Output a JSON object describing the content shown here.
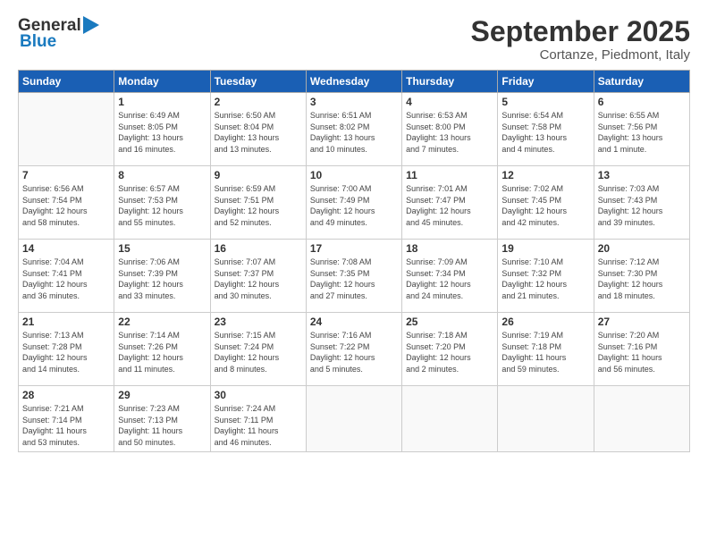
{
  "header": {
    "logo_line1": "General",
    "logo_line2": "Blue",
    "month": "September 2025",
    "location": "Cortanze, Piedmont, Italy"
  },
  "days_of_week": [
    "Sunday",
    "Monday",
    "Tuesday",
    "Wednesday",
    "Thursday",
    "Friday",
    "Saturday"
  ],
  "weeks": [
    [
      {
        "day": "",
        "info": ""
      },
      {
        "day": "1",
        "info": "Sunrise: 6:49 AM\nSunset: 8:05 PM\nDaylight: 13 hours\nand 16 minutes."
      },
      {
        "day": "2",
        "info": "Sunrise: 6:50 AM\nSunset: 8:04 PM\nDaylight: 13 hours\nand 13 minutes."
      },
      {
        "day": "3",
        "info": "Sunrise: 6:51 AM\nSunset: 8:02 PM\nDaylight: 13 hours\nand 10 minutes."
      },
      {
        "day": "4",
        "info": "Sunrise: 6:53 AM\nSunset: 8:00 PM\nDaylight: 13 hours\nand 7 minutes."
      },
      {
        "day": "5",
        "info": "Sunrise: 6:54 AM\nSunset: 7:58 PM\nDaylight: 13 hours\nand 4 minutes."
      },
      {
        "day": "6",
        "info": "Sunrise: 6:55 AM\nSunset: 7:56 PM\nDaylight: 13 hours\nand 1 minute."
      }
    ],
    [
      {
        "day": "7",
        "info": "Sunrise: 6:56 AM\nSunset: 7:54 PM\nDaylight: 12 hours\nand 58 minutes."
      },
      {
        "day": "8",
        "info": "Sunrise: 6:57 AM\nSunset: 7:53 PM\nDaylight: 12 hours\nand 55 minutes."
      },
      {
        "day": "9",
        "info": "Sunrise: 6:59 AM\nSunset: 7:51 PM\nDaylight: 12 hours\nand 52 minutes."
      },
      {
        "day": "10",
        "info": "Sunrise: 7:00 AM\nSunset: 7:49 PM\nDaylight: 12 hours\nand 49 minutes."
      },
      {
        "day": "11",
        "info": "Sunrise: 7:01 AM\nSunset: 7:47 PM\nDaylight: 12 hours\nand 45 minutes."
      },
      {
        "day": "12",
        "info": "Sunrise: 7:02 AM\nSunset: 7:45 PM\nDaylight: 12 hours\nand 42 minutes."
      },
      {
        "day": "13",
        "info": "Sunrise: 7:03 AM\nSunset: 7:43 PM\nDaylight: 12 hours\nand 39 minutes."
      }
    ],
    [
      {
        "day": "14",
        "info": "Sunrise: 7:04 AM\nSunset: 7:41 PM\nDaylight: 12 hours\nand 36 minutes."
      },
      {
        "day": "15",
        "info": "Sunrise: 7:06 AM\nSunset: 7:39 PM\nDaylight: 12 hours\nand 33 minutes."
      },
      {
        "day": "16",
        "info": "Sunrise: 7:07 AM\nSunset: 7:37 PM\nDaylight: 12 hours\nand 30 minutes."
      },
      {
        "day": "17",
        "info": "Sunrise: 7:08 AM\nSunset: 7:35 PM\nDaylight: 12 hours\nand 27 minutes."
      },
      {
        "day": "18",
        "info": "Sunrise: 7:09 AM\nSunset: 7:34 PM\nDaylight: 12 hours\nand 24 minutes."
      },
      {
        "day": "19",
        "info": "Sunrise: 7:10 AM\nSunset: 7:32 PM\nDaylight: 12 hours\nand 21 minutes."
      },
      {
        "day": "20",
        "info": "Sunrise: 7:12 AM\nSunset: 7:30 PM\nDaylight: 12 hours\nand 18 minutes."
      }
    ],
    [
      {
        "day": "21",
        "info": "Sunrise: 7:13 AM\nSunset: 7:28 PM\nDaylight: 12 hours\nand 14 minutes."
      },
      {
        "day": "22",
        "info": "Sunrise: 7:14 AM\nSunset: 7:26 PM\nDaylight: 12 hours\nand 11 minutes."
      },
      {
        "day": "23",
        "info": "Sunrise: 7:15 AM\nSunset: 7:24 PM\nDaylight: 12 hours\nand 8 minutes."
      },
      {
        "day": "24",
        "info": "Sunrise: 7:16 AM\nSunset: 7:22 PM\nDaylight: 12 hours\nand 5 minutes."
      },
      {
        "day": "25",
        "info": "Sunrise: 7:18 AM\nSunset: 7:20 PM\nDaylight: 12 hours\nand 2 minutes."
      },
      {
        "day": "26",
        "info": "Sunrise: 7:19 AM\nSunset: 7:18 PM\nDaylight: 11 hours\nand 59 minutes."
      },
      {
        "day": "27",
        "info": "Sunrise: 7:20 AM\nSunset: 7:16 PM\nDaylight: 11 hours\nand 56 minutes."
      }
    ],
    [
      {
        "day": "28",
        "info": "Sunrise: 7:21 AM\nSunset: 7:14 PM\nDaylight: 11 hours\nand 53 minutes."
      },
      {
        "day": "29",
        "info": "Sunrise: 7:23 AM\nSunset: 7:13 PM\nDaylight: 11 hours\nand 50 minutes."
      },
      {
        "day": "30",
        "info": "Sunrise: 7:24 AM\nSunset: 7:11 PM\nDaylight: 11 hours\nand 46 minutes."
      },
      {
        "day": "",
        "info": ""
      },
      {
        "day": "",
        "info": ""
      },
      {
        "day": "",
        "info": ""
      },
      {
        "day": "",
        "info": ""
      }
    ]
  ]
}
